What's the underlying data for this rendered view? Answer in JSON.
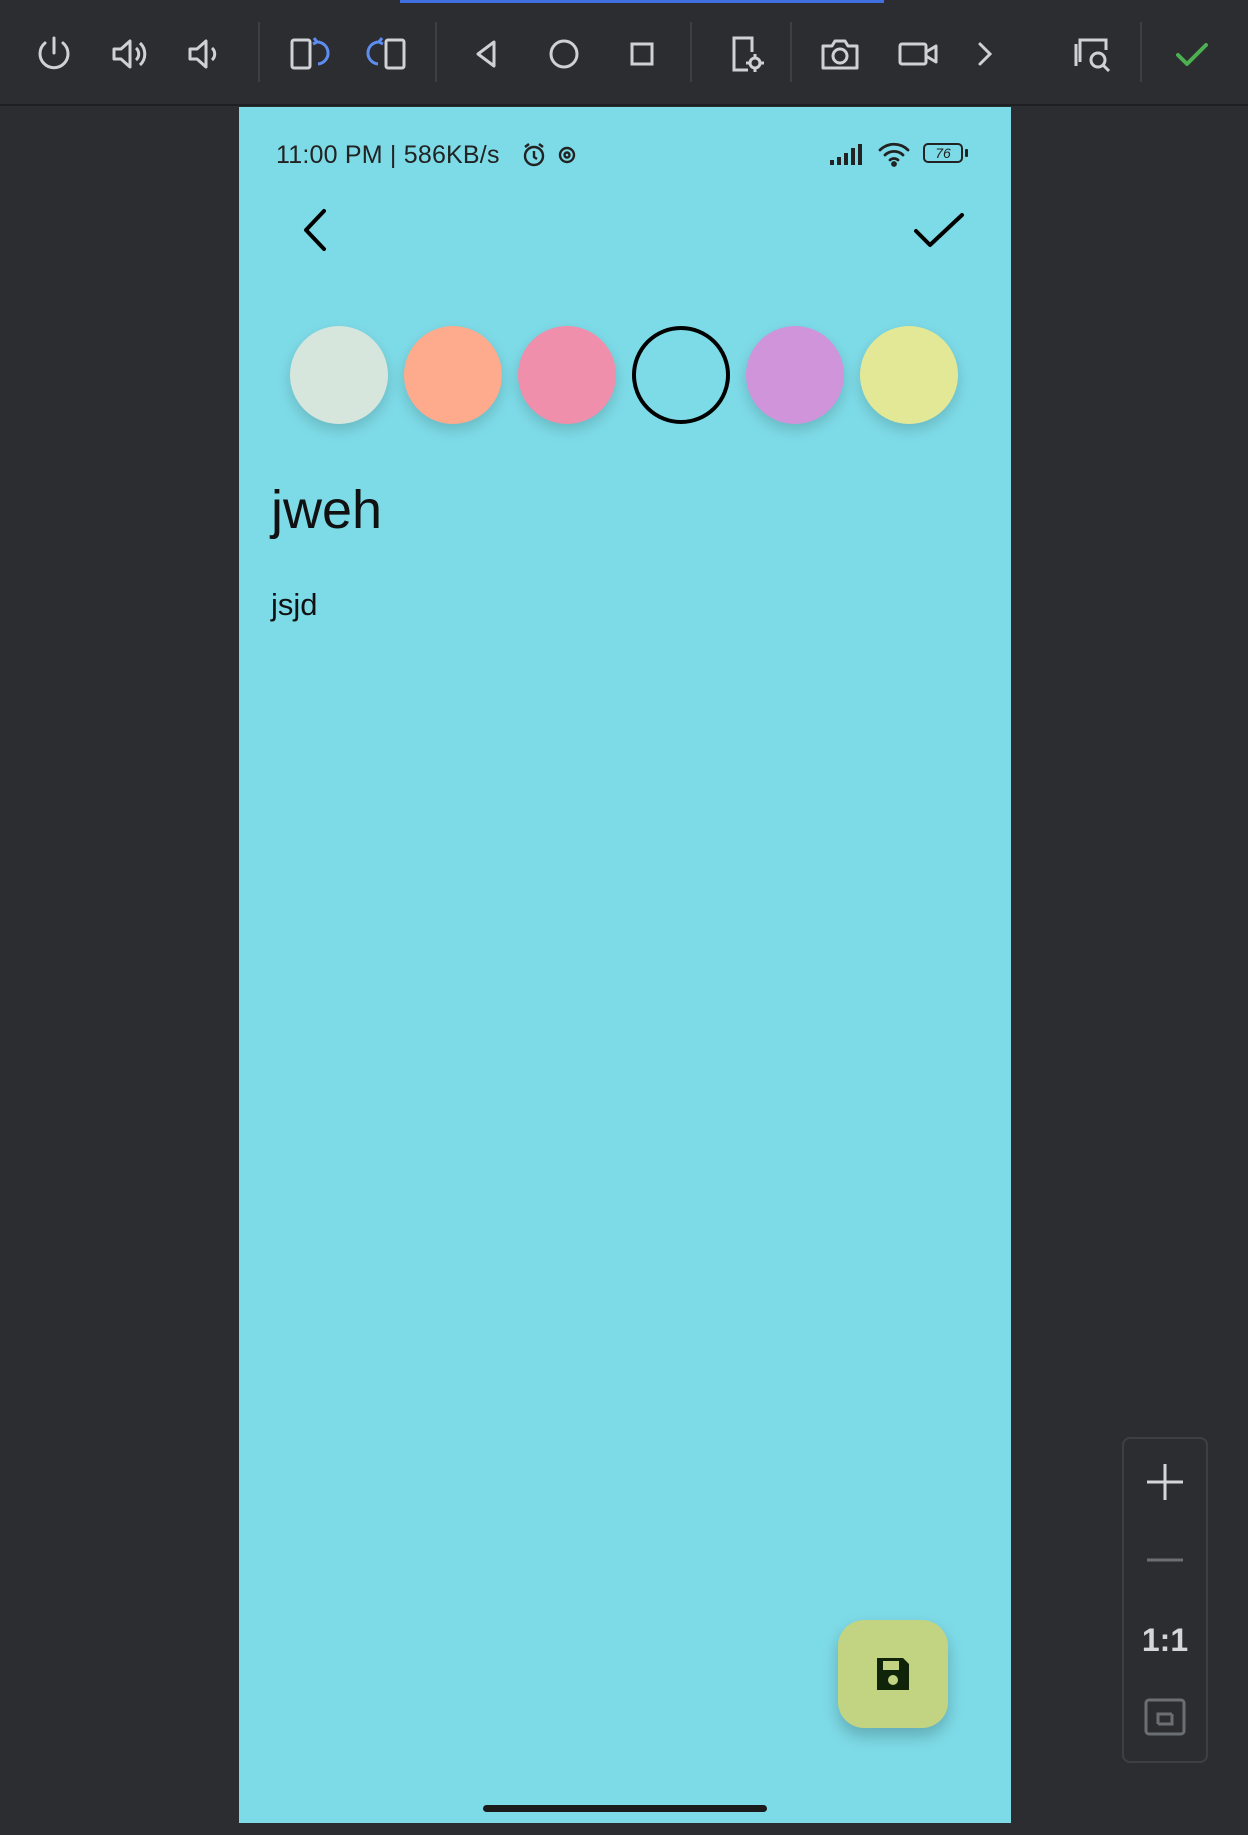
{
  "toolbar": {
    "icons": [
      "power-icon",
      "volume-up-icon",
      "volume-down-icon",
      "rotate-left-icon",
      "rotate-right-icon",
      "back-icon",
      "home-icon",
      "overview-icon",
      "device-settings-icon",
      "camera-icon",
      "screen-record-icon",
      "chevron-right-icon",
      "inspect-icon",
      "check-icon"
    ],
    "accent": "#3f6fe0",
    "check_color": "#4caf50"
  },
  "status_bar": {
    "time_speed": "11:00 PM | 586KB/s",
    "battery": "76"
  },
  "colors": {
    "swatches": [
      "#d6e6dd",
      "#fdab8c",
      "#f08fab",
      "#7ddbe7",
      "#cf94d9",
      "#e3e897"
    ],
    "selected_index": 3,
    "fab": "#c2d482",
    "screen_bg": "#7ddbe7"
  },
  "note": {
    "title": "jweh",
    "body": "jsjd"
  },
  "zoom": {
    "ratio_label": "1:1"
  }
}
